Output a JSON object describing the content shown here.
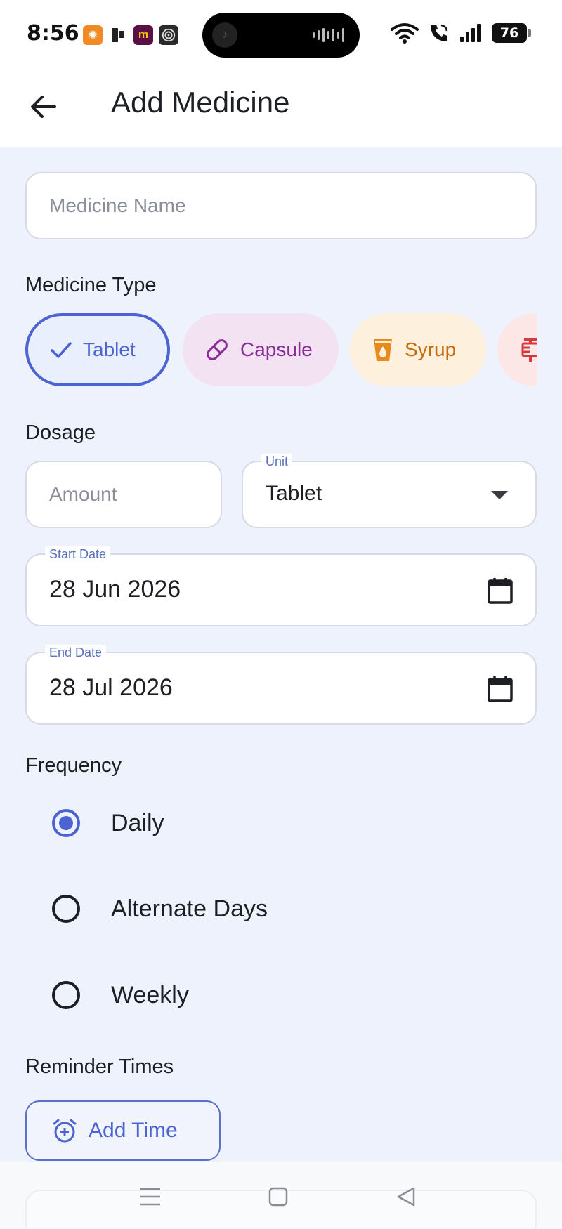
{
  "status_bar": {
    "time": "8:56",
    "battery": "76",
    "app_icons": [
      {
        "name": "app-icon-orange",
        "glyph": "✺",
        "color": "#f08a24"
      },
      {
        "name": "app-icon-phone",
        "glyph": "▮",
        "color": "#222222"
      },
      {
        "name": "app-icon-m",
        "glyph": "m",
        "color": "#5b0f47"
      },
      {
        "name": "app-icon-spiral",
        "glyph": "◎",
        "color": "#2a2a2a"
      }
    ]
  },
  "app_bar": {
    "title": "Add Medicine",
    "back_icon": "arrow-left-icon"
  },
  "form": {
    "medicine_name": {
      "placeholder": "Medicine Name",
      "value": ""
    },
    "medicine_type": {
      "label": "Medicine Type",
      "options": [
        {
          "label": "Tablet",
          "icon": "check-icon",
          "selected": true
        },
        {
          "label": "Capsule",
          "icon": "pill-icon",
          "selected": false
        },
        {
          "label": "Syrup",
          "icon": "syrup-icon",
          "selected": false
        },
        {
          "label": "",
          "icon": "syringe-icon",
          "selected": false
        }
      ]
    },
    "dosage": {
      "label": "Dosage",
      "amount_placeholder": "Amount",
      "unit_label": "Unit",
      "unit_value": "Tablet"
    },
    "start_date": {
      "label": "Start Date",
      "value": "28 Jun 2026"
    },
    "end_date": {
      "label": "End Date",
      "value": "28 Jul 2026"
    },
    "frequency": {
      "label": "Frequency",
      "options": [
        {
          "label": "Daily",
          "selected": true
        },
        {
          "label": "Alternate Days",
          "selected": false
        },
        {
          "label": "Weekly",
          "selected": false
        }
      ]
    },
    "reminder": {
      "label": "Reminder Times",
      "add_button": "Add Time"
    }
  },
  "colors": {
    "accent": "#4b63d3",
    "background": "#eef2fc",
    "capsule": "#8c2c9a",
    "syrup": "#c76a0a",
    "injection": "#d33b3b"
  }
}
